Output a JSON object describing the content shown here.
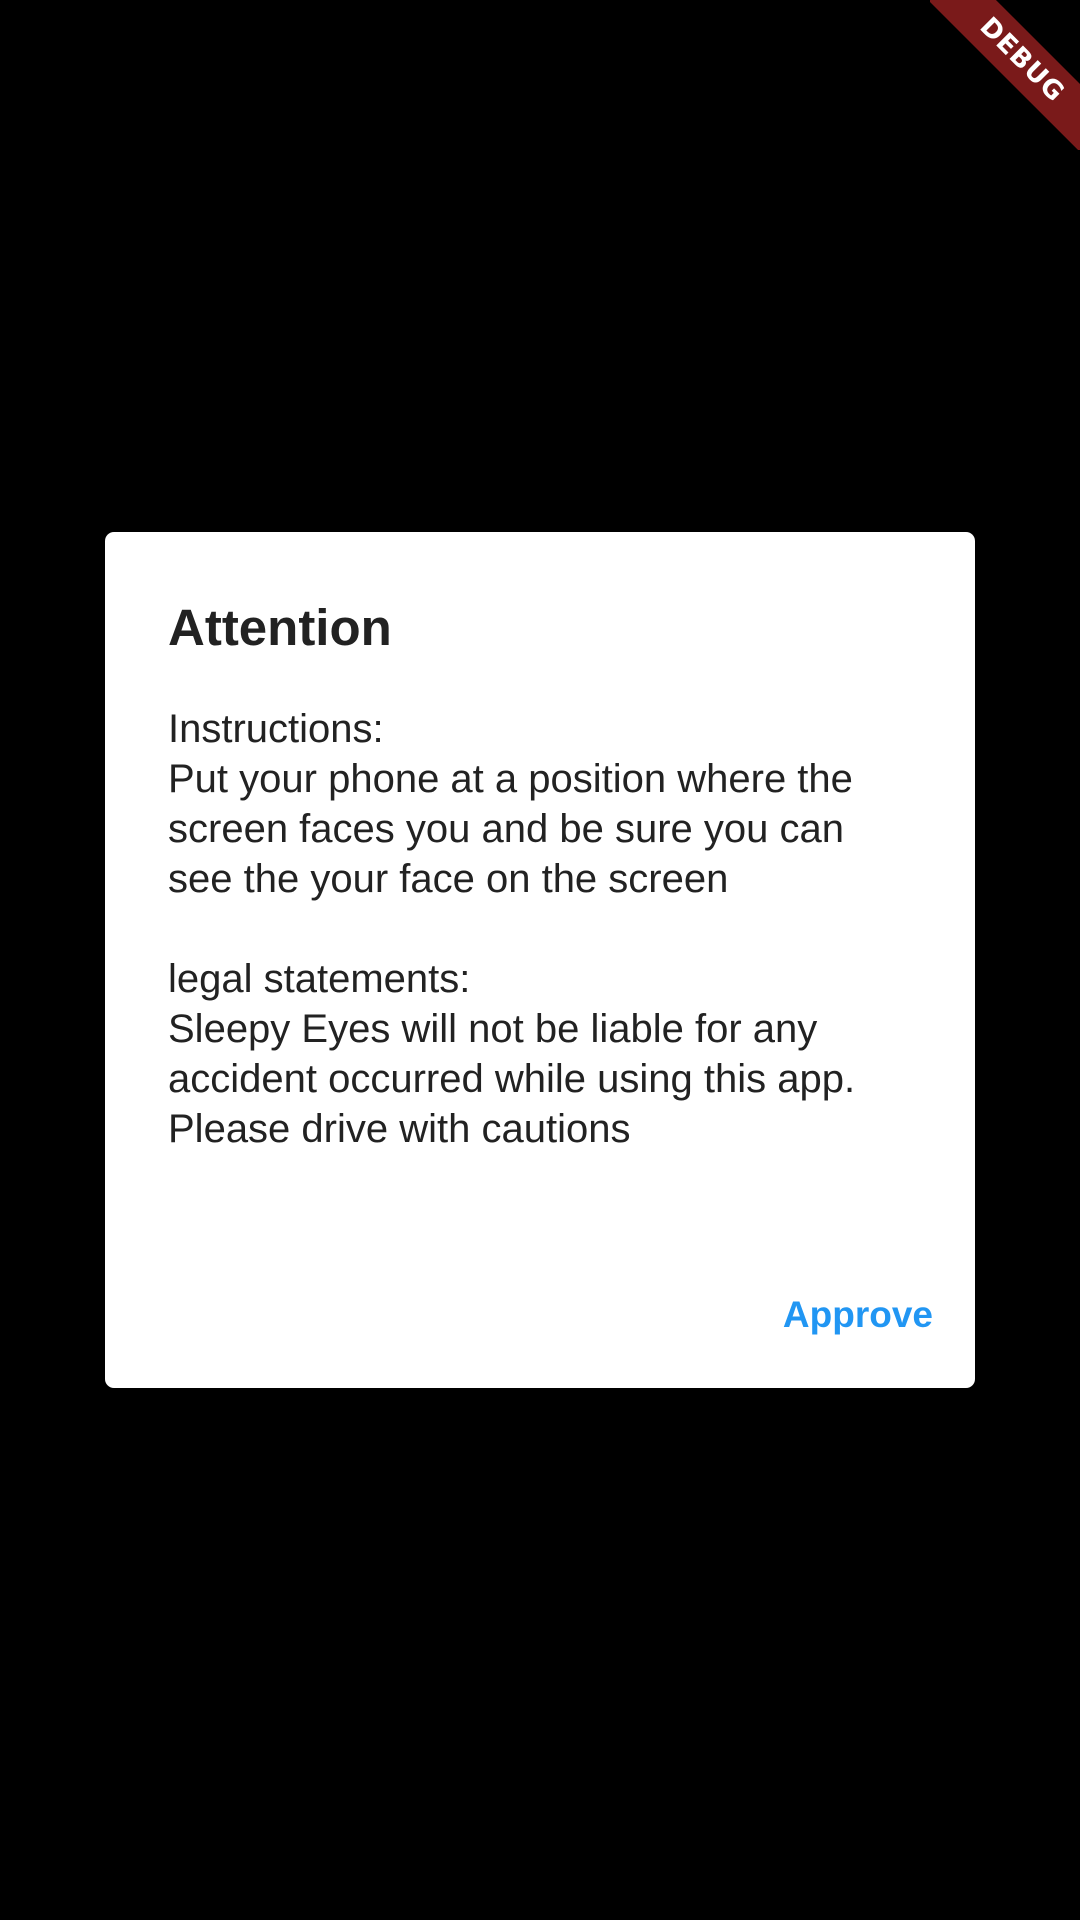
{
  "debug_banner": {
    "label": "DEBUG",
    "color": "#7a1a1a"
  },
  "dialog": {
    "title": "Attention",
    "instructions_heading": "Instructions:",
    "instructions_lines": [
      "Put your phone at a position where the",
      "screen faces you and be sure you can",
      "see the your face on the screen"
    ],
    "legal_heading": "legal statements:",
    "legal_lines": [
      "Sleepy Eyes will not be liable for any",
      "accident occurred while using this app.",
      "Please drive with cautions"
    ],
    "approve_label": "Approve",
    "accent_color": "#2196f3"
  }
}
